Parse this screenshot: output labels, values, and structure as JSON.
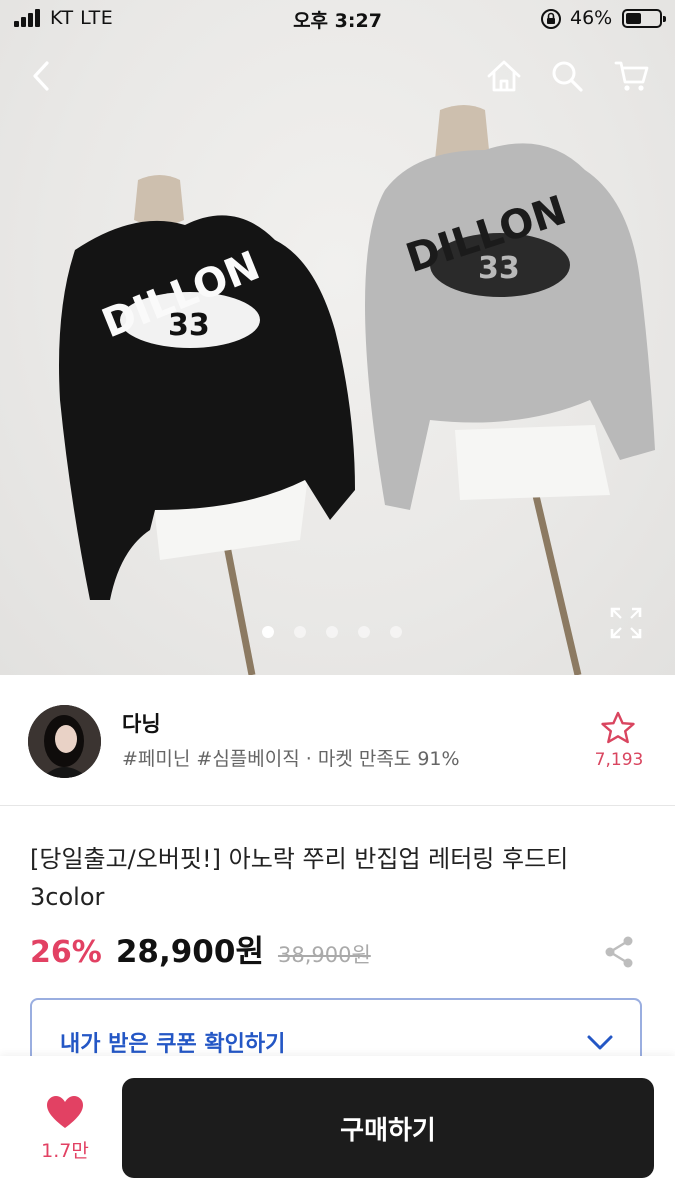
{
  "status_bar": {
    "carrier": "KT  LTE",
    "time": "오후 3:27",
    "battery": "46%",
    "battery_level": 0.46
  },
  "gallery": {
    "slide_count": 5,
    "active_index": 0,
    "print_text_left": "DILLON",
    "print_text_right": "DILLON",
    "print_number": "33"
  },
  "seller": {
    "name": "다닝",
    "tags": "#페미닌 #심플베이직 · 마켓 만족도 91%",
    "favorite_count": "7,193"
  },
  "product": {
    "title": "[당일출고/오버핏!] 아노락 쭈리 반집업 레터링 후드티 3color",
    "discount": "26%",
    "price": "28,900원",
    "original_price": "38,900원"
  },
  "coupon": {
    "label": "내가 받은 쿠폰 확인하기"
  },
  "bottom_bar": {
    "like_count": "1.7만",
    "buy_label": "구매하기"
  },
  "colors": {
    "accent_pink": "#e24163",
    "coupon_blue": "#2457c5",
    "buy_button": "#1c1c1c"
  }
}
